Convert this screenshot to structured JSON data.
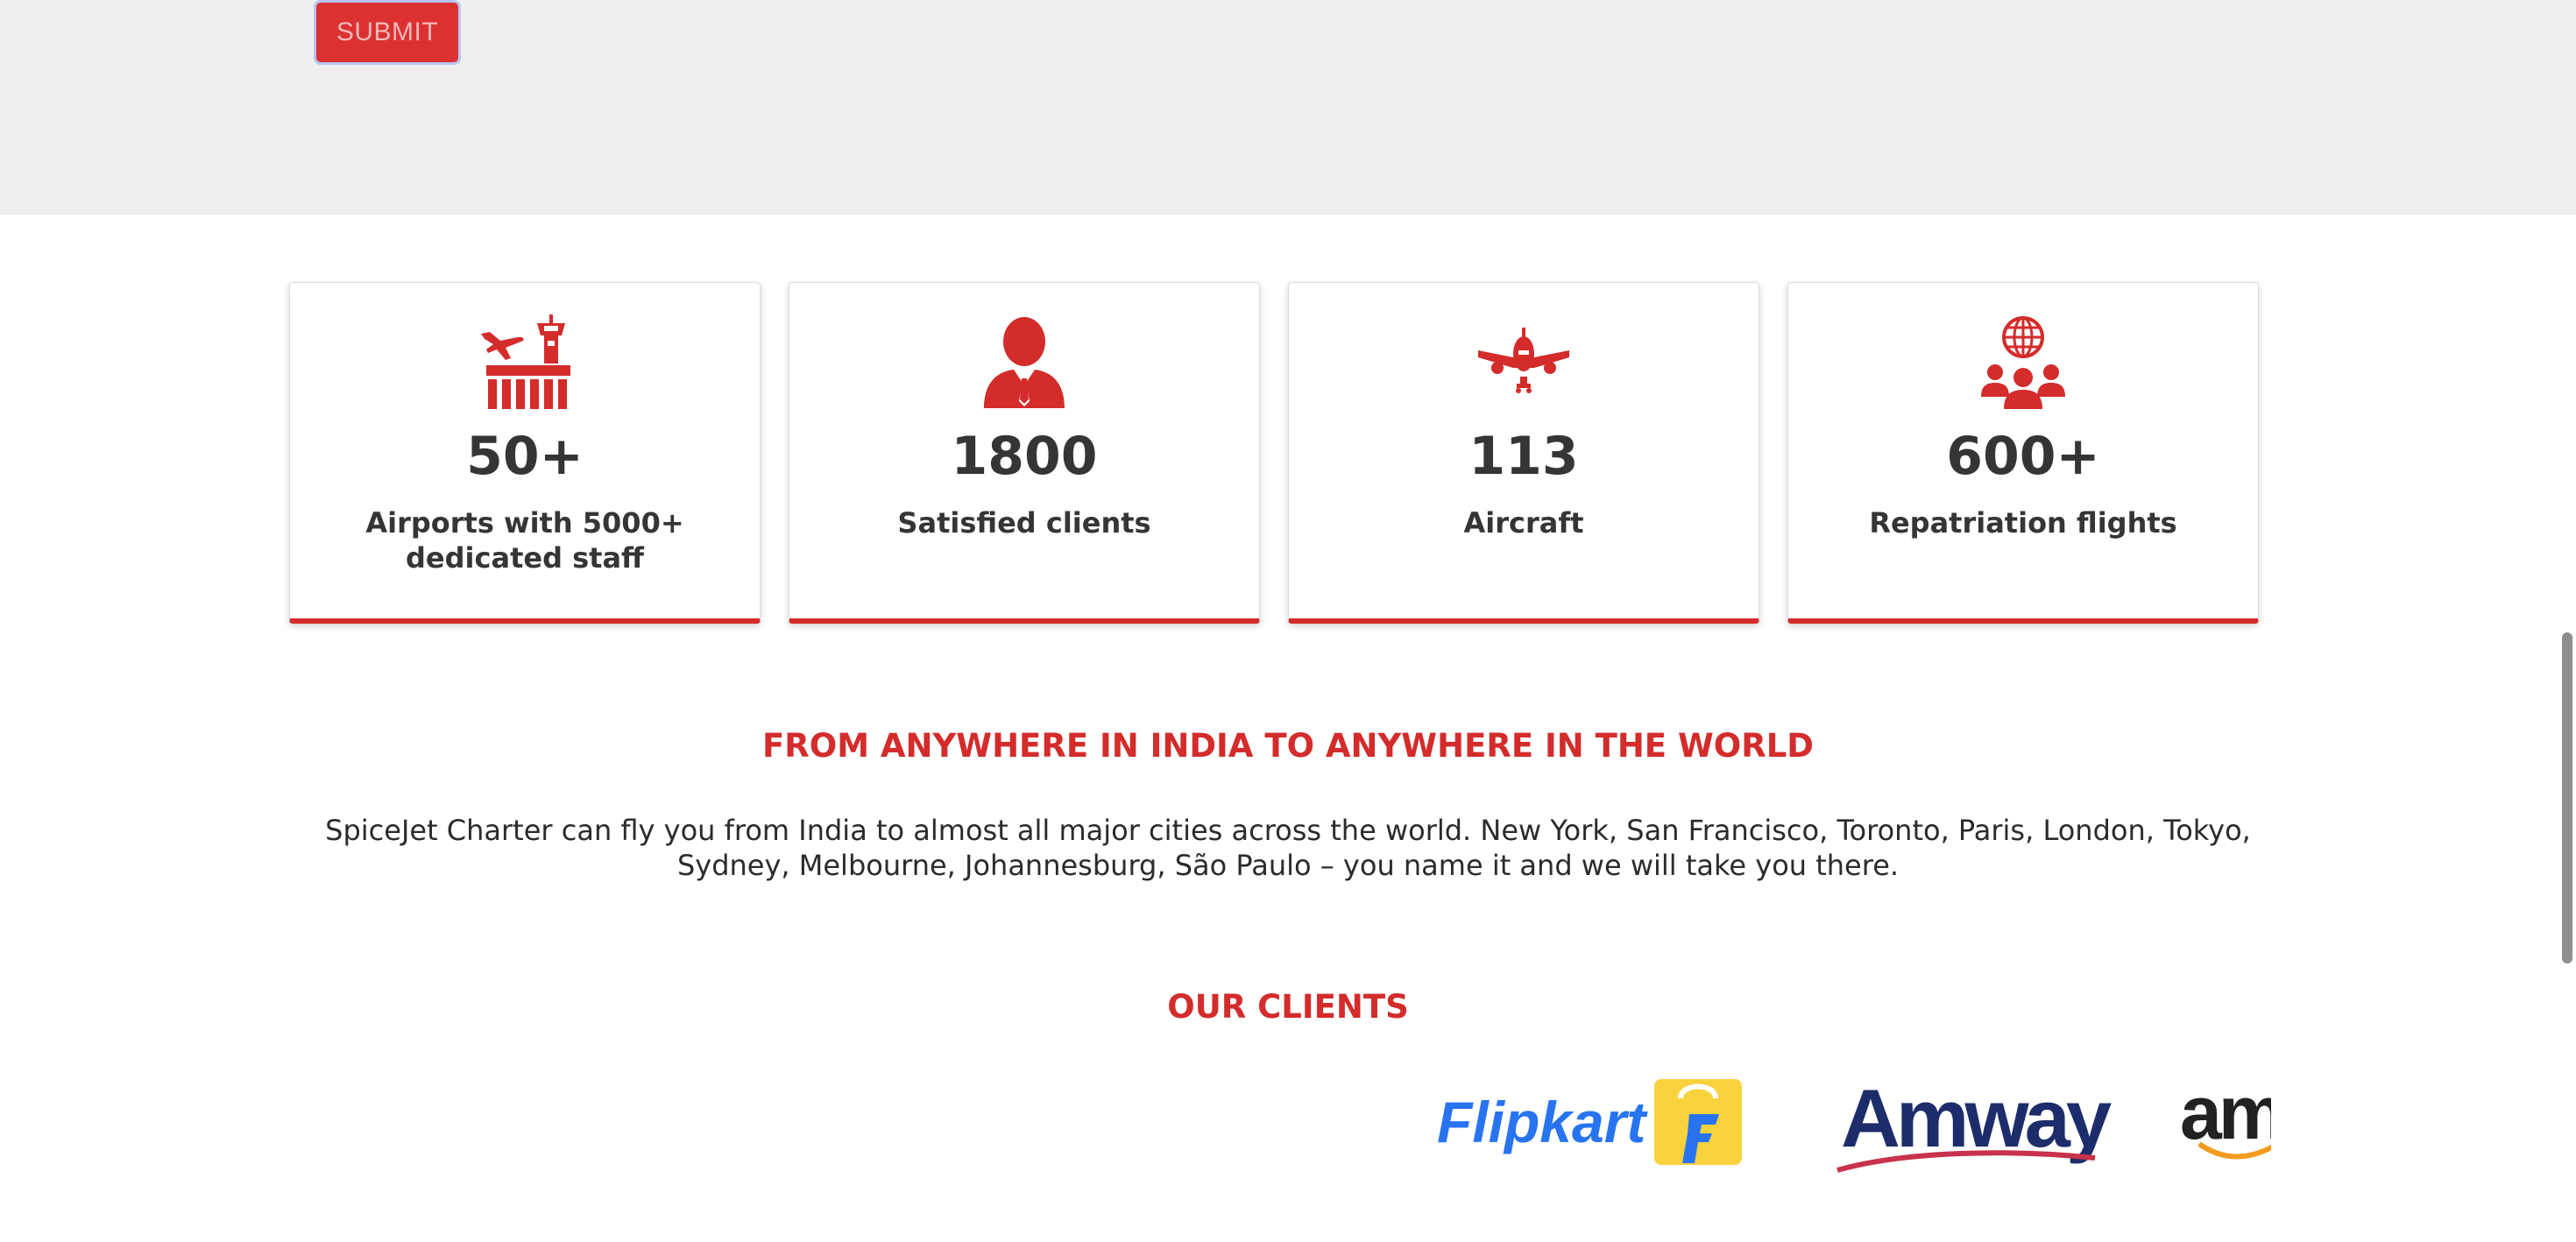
{
  "form": {
    "submit_label": "SUBMIT"
  },
  "stats": [
    {
      "icon": "airport-tower-icon",
      "value": "50+",
      "label": "Airports with 5000+ dedicated staff"
    },
    {
      "icon": "client-person-icon",
      "value": "1800",
      "label": "Satisfied clients"
    },
    {
      "icon": "aircraft-icon",
      "value": "113",
      "label": "Aircraft"
    },
    {
      "icon": "global-people-icon",
      "value": "600+",
      "label": "Repatriation flights"
    }
  ],
  "destinations": {
    "heading": "FROM ANYWHERE IN INDIA TO ANYWHERE IN THE WORLD",
    "description": "SpiceJet Charter can fly you from India to almost all major cities across the world. New York, San Francisco, Toronto, Paris, London, Tokyo, Sydney, Melbourne, Johannesburg, São Paulo – you name it and we will take you there."
  },
  "clients": {
    "heading": "OUR CLIENTS",
    "logos": {
      "flipkart": "Flipkart",
      "amway": "Amway",
      "amazon": "am"
    }
  },
  "colors": {
    "brand_red": "#d42b2b",
    "text_dark": "#353535",
    "form_bg": "#efefef"
  }
}
